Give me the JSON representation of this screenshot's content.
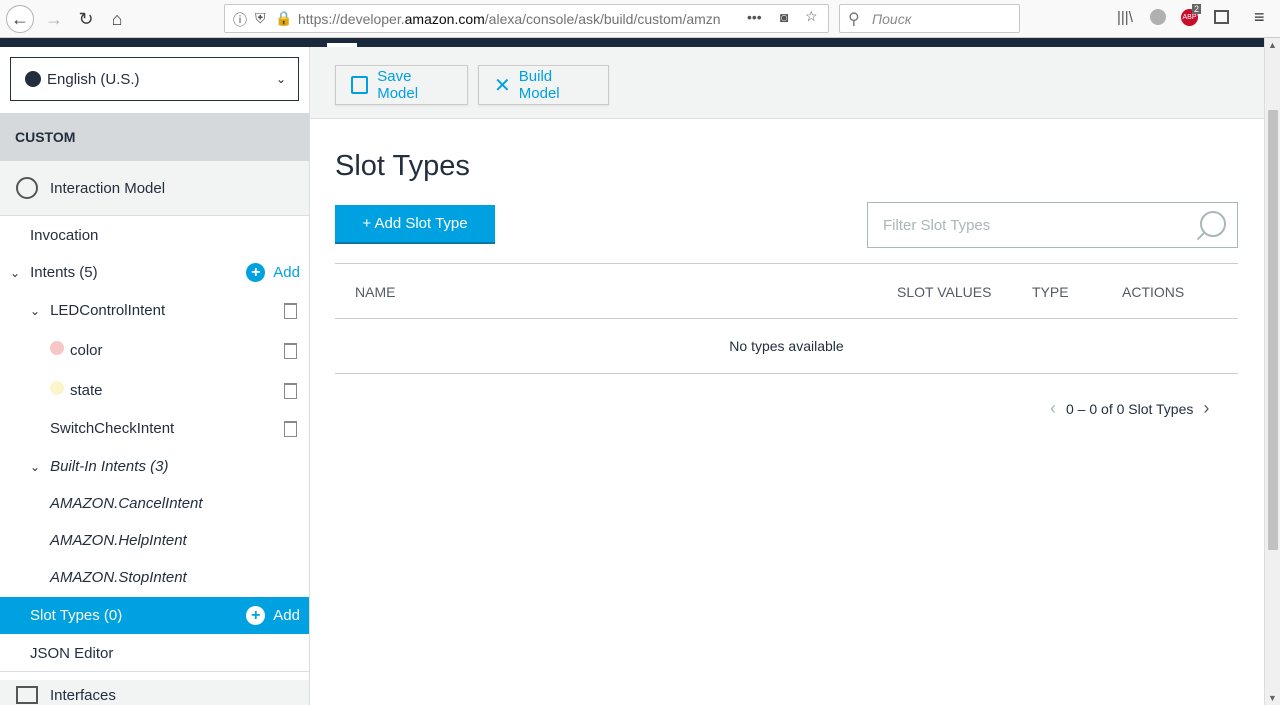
{
  "browser": {
    "url_prefix": "https://developer.",
    "url_domain": "amazon.com",
    "url_suffix": "/alexa/console/ask/build/custom/amzn",
    "search_placeholder": "Поиск",
    "addon_badge": "2",
    "addon_label": "ABP"
  },
  "sidebar": {
    "language": "English (U.S.)",
    "section_header": "CUSTOM",
    "interaction_model": "Interaction Model",
    "invocation": "Invocation",
    "intents_label": "Intents (5)",
    "add_label": "Add",
    "intent_name": "LEDControlIntent",
    "slots": [
      {
        "name": "color",
        "color": "#f7c6c6"
      },
      {
        "name": "state",
        "color": "#fcf5cc"
      }
    ],
    "switch_intent": "SwitchCheckIntent",
    "builtin_label": "Built-In Intents (3)",
    "builtin_intents": [
      "AMAZON.CancelIntent",
      "AMAZON.HelpIntent",
      "AMAZON.StopIntent"
    ],
    "slot_types_label": "Slot Types (0)",
    "json_editor": "JSON Editor",
    "interfaces": "Interfaces"
  },
  "toolbar": {
    "save_label": "Save Model",
    "build_label": "Build Model"
  },
  "main": {
    "title": "Slot Types",
    "add_button": "+ Add Slot Type",
    "filter_placeholder": "Filter Slot Types",
    "columns": [
      "NAME",
      "SLOT VALUES",
      "TYPE",
      "ACTIONS"
    ],
    "empty_message": "No types available",
    "pagination": "0 – 0 of 0 Slot Types"
  },
  "colors": {
    "accent": "#00a1e0",
    "dark": "#232f3e"
  }
}
